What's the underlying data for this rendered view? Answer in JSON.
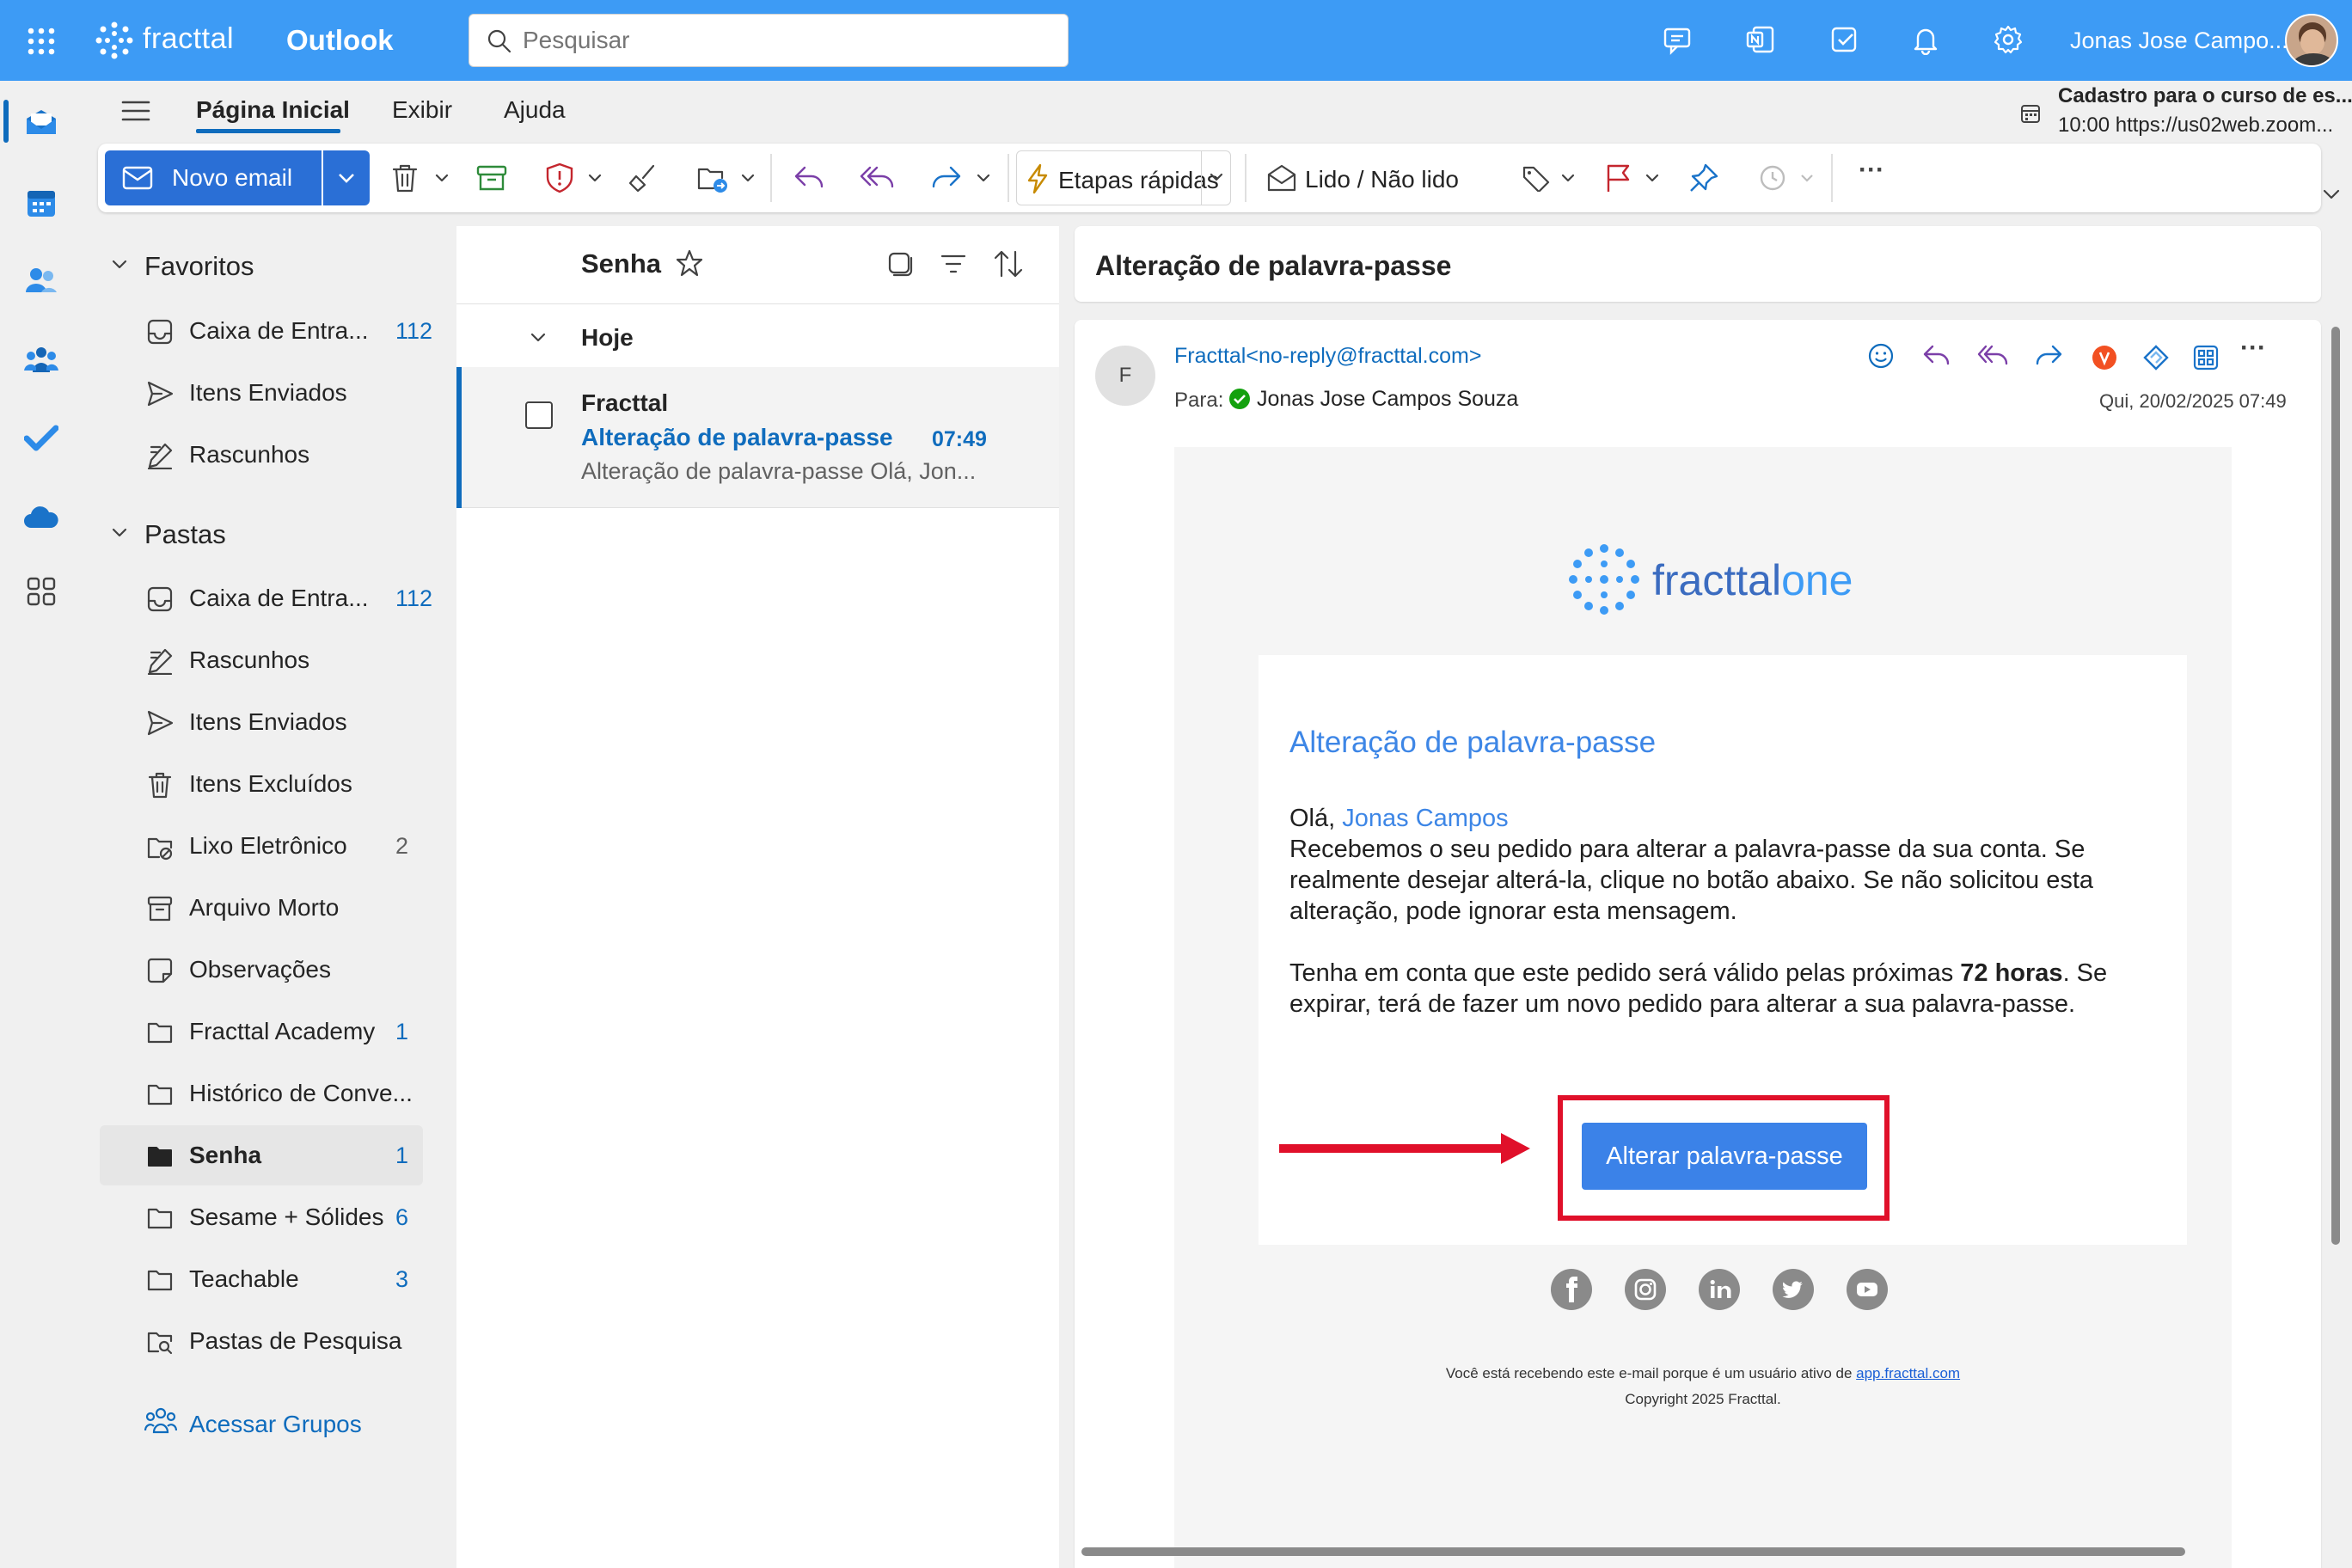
{
  "topbar": {
    "brand": "fracttal",
    "app_name": "Outlook",
    "search_placeholder": "Pesquisar",
    "user_name": "Jonas Jose Campo...",
    "icons": [
      "waffle-icon",
      "teams-chat-icon",
      "onenote-icon",
      "todo-icon",
      "bell-icon",
      "gear-icon"
    ]
  },
  "rail": {
    "icons": [
      "mail-icon",
      "calendar-icon",
      "people-icon",
      "groups-icon",
      "todo-icon",
      "onedrive-icon",
      "apps-icon"
    ]
  },
  "nav": {
    "tabs": [
      "Página Inicial",
      "Exibir",
      "Ajuda"
    ],
    "reminder": {
      "title": "Cadastro para o curso de es...",
      "detail": "10:00 https://us02web.zoom..."
    }
  },
  "ribbon": {
    "new_email": "Novo email",
    "quick_steps": "Etapas rápidas",
    "read_unread": "Lido / Não lido",
    "more": "···"
  },
  "folders": {
    "favorites_header": "Favoritos",
    "folders_header": "Pastas",
    "favorites": [
      {
        "label": "Caixa de Entra...",
        "count": "112",
        "icon": "inbox-icon"
      },
      {
        "label": "Itens Enviados",
        "count": "",
        "icon": "send-icon"
      },
      {
        "label": "Rascunhos",
        "count": "",
        "icon": "draft-icon"
      }
    ],
    "items": [
      {
        "label": "Caixa de Entra...",
        "count": "112",
        "icon": "inbox-icon"
      },
      {
        "label": "Rascunhos",
        "count": "",
        "icon": "draft-icon"
      },
      {
        "label": "Itens Enviados",
        "count": "",
        "icon": "send-icon"
      },
      {
        "label": "Itens Excluídos",
        "count": "",
        "icon": "trash-icon"
      },
      {
        "label": "Lixo Eletrônico",
        "count": "2",
        "icon": "junk-icon"
      },
      {
        "label": "Arquivo Morto",
        "count": "",
        "icon": "archive-icon"
      },
      {
        "label": "Observações",
        "count": "",
        "icon": "note-icon"
      },
      {
        "label": "Fracttal Academy",
        "count": "1",
        "icon": "folder-icon"
      },
      {
        "label": "Histórico de Conve...",
        "count": "",
        "icon": "folder-icon"
      },
      {
        "label": "Senha",
        "count": "1",
        "icon": "folder-filled-icon"
      },
      {
        "label": "Sesame + Sólides",
        "count": "6",
        "icon": "folder-icon"
      },
      {
        "label": "Teachable",
        "count": "3",
        "icon": "folder-icon"
      },
      {
        "label": "Pastas de Pesquisa",
        "count": "",
        "icon": "search-folder-icon"
      }
    ],
    "groups_link": "Acessar Grupos"
  },
  "list": {
    "folder_title": "Senha",
    "group_header": "Hoje",
    "messages": [
      {
        "sender": "Fracttal",
        "subject": "Alteração de palavra-passe",
        "time": "07:49",
        "preview": "Alteração de palavra-passe Olá, Jon..."
      }
    ]
  },
  "reading": {
    "subject": "Alteração de palavra-passe",
    "avatar_letter": "F",
    "from": "Fracttal<no-reply@fracttal.com>",
    "to_label": "Para:",
    "to_name": "Jonas Jose Campos Souza",
    "date": "Qui, 20/02/2025 07:49",
    "email": {
      "logo_main": "fracttal",
      "logo_suffix": "one",
      "heading": "Alteração de palavra-passe",
      "greeting": "Olá,",
      "greeting_name": "Jonas Campos",
      "para1": "Recebemos o seu pedido para alterar a palavra-passe da sua conta. Se realmente desejar alterá-la, clique no botão abaixo. Se não solicitou esta alteração, pode ignorar esta mensagem.",
      "para2_before": "Tenha em conta que este pedido será válido pelas próximas ",
      "para2_bold": "72 horas",
      "para2_after": ". Se expirar, terá de fazer um novo pedido para alterar a sua palavra-passe.",
      "button": "Alterar palavra-passe",
      "footer_before": "Você está recebendo este e-mail porque é um usuário ativo de ",
      "footer_link": "app.fracttal.com",
      "copyright": "Copyright 2025 Fracttal.",
      "social": [
        "facebook-icon",
        "instagram-icon",
        "linkedin-icon",
        "twitter-icon",
        "youtube-icon"
      ]
    }
  },
  "colors": {
    "brand_blue": "#3d9bf5",
    "accent": "#0f6cbd",
    "email_button": "#3b82e8",
    "highlight": "#e0102a"
  }
}
